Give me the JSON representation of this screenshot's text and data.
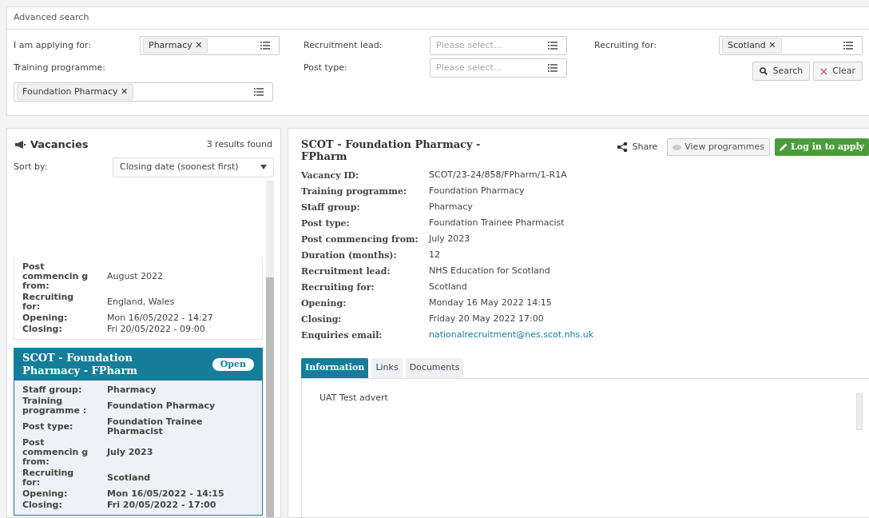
{
  "search": {
    "title": "Advanced search",
    "fields": [
      {
        "label": "I am applying for:",
        "kind": "tags",
        "tags": [
          "Pharmacy"
        ]
      },
      {
        "label": "Recruitment lead:",
        "kind": "select",
        "placeholder": "Please select..."
      },
      {
        "label": "Recruiting for:",
        "kind": "tags",
        "tags": [
          "Scotland"
        ]
      },
      {
        "label": "Training programme:",
        "kind": "tags",
        "tags": [
          "Foundation Pharmacy"
        ]
      },
      {
        "label": "Post type:",
        "kind": "select",
        "placeholder": "Please select..."
      }
    ],
    "tag_remove": "✕",
    "buttons": [
      {
        "label": "Search",
        "kind": "search"
      },
      {
        "label": "Clear",
        "kind": "clear"
      }
    ]
  },
  "vacancies": {
    "title": "Vacancies",
    "count": "3 results found",
    "sort_label": "Sort by:",
    "sort_value": "Closing date (soonest first)",
    "cards": [
      {
        "selected": false,
        "rows": [
          {
            "label": "Post commencin g from:",
            "value": "August 2022"
          },
          {
            "label": "Recruiting for:",
            "value": "England, Wales"
          },
          {
            "label": "Opening:",
            "value": "Mon 16/05/2022 - 14:27"
          },
          {
            "label": "Closing:",
            "value": "Fri 20/05/2022 - 09:00"
          }
        ]
      },
      {
        "selected": true,
        "title": "SCOT - Foundation Pharmacy - FPharm",
        "status": "Open",
        "rows": [
          {
            "label": "Staff group:",
            "value": "Pharmacy"
          },
          {
            "label": "Training programme :",
            "value": "Foundation Pharmacy"
          },
          {
            "label": "Post type:",
            "value": "Foundation Trainee Pharmacist"
          },
          {
            "label": "Post commencin g from:",
            "value": "July 2023"
          },
          {
            "label": "Recruiting for:",
            "value": "Scotland"
          },
          {
            "label": "Opening:",
            "value": "Mon 16/05/2022 - 14:15"
          },
          {
            "label": "Closing:",
            "value": "Fri 20/05/2022 - 17:00"
          }
        ]
      }
    ]
  },
  "detail": {
    "title": "SCOT - Foundation Pharmacy - FPharm",
    "actions": [
      {
        "label": "Share",
        "kind": "share"
      },
      {
        "label": "View programmes",
        "kind": "view"
      },
      {
        "label": "Log in to apply",
        "kind": "apply"
      }
    ],
    "fields": [
      {
        "label": "Vacancy ID:",
        "value": "SCOT/23-24/858/FPharm/1-R1A",
        "kind": "text"
      },
      {
        "label": "Training programme:",
        "value": "Foundation Pharmacy",
        "kind": "text"
      },
      {
        "label": "Staff group:",
        "value": "Pharmacy",
        "kind": "text"
      },
      {
        "label": "Post type:",
        "value": "Foundation Trainee Pharmacist",
        "kind": "text"
      },
      {
        "label": "Post commencing from:",
        "value": "July 2023",
        "kind": "text"
      },
      {
        "label": "Duration (months):",
        "value": "12",
        "kind": "text"
      },
      {
        "label": "Recruitment lead:",
        "value": "NHS Education for Scotland",
        "kind": "text"
      },
      {
        "label": "Recruiting for:",
        "value": "Scotland",
        "kind": "text"
      },
      {
        "label": "Opening:",
        "value": "Monday 16 May 2022 14:15",
        "kind": "text"
      },
      {
        "label": "Closing:",
        "value": "Friday 20 May 2022 17:00",
        "kind": "text"
      },
      {
        "label": "Enquiries email:",
        "value": "nationalrecruitment@nes.scot.nhs.uk",
        "kind": "link"
      }
    ],
    "tabs": [
      {
        "label": "Information",
        "selected": true
      },
      {
        "label": "Links",
        "selected": false
      },
      {
        "label": "Documents",
        "selected": false
      }
    ],
    "content": "UAT Test advert"
  }
}
